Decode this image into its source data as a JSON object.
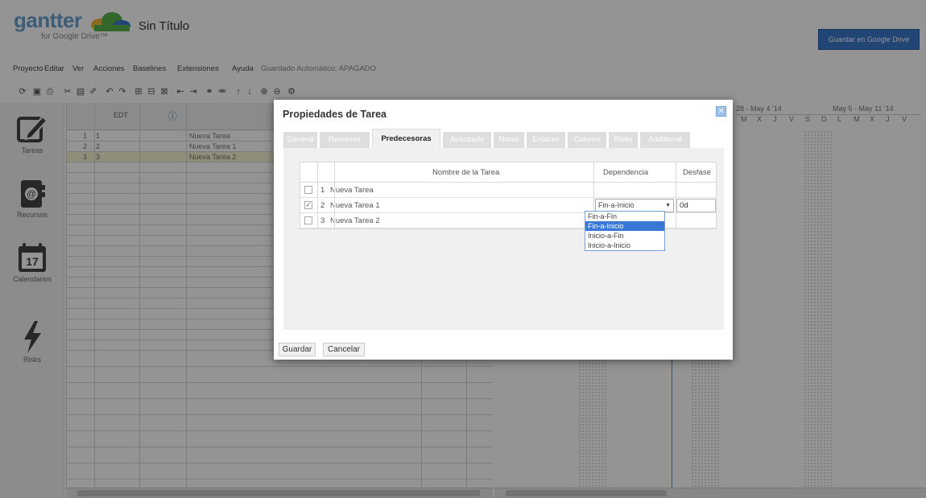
{
  "app": {
    "logo_text": "gantter",
    "logo_sub": "for Google Drive™",
    "title": "Sin Título",
    "save_drive": "Guardar en Google Drive"
  },
  "menu": [
    "Proyecto",
    "Editar",
    "Ver",
    "Acciones",
    "Baselines",
    "Extensiones",
    "Ayuda",
    "Guardado Automático: APAGADO"
  ],
  "nav": [
    {
      "label": "Tareas",
      "icon": "edit-icon"
    },
    {
      "label": "Recursos",
      "icon": "contacts-icon"
    },
    {
      "label": "Calendarios",
      "icon": "calendar-icon",
      "number": "17"
    },
    {
      "label": "Risks",
      "icon": "lightning-icon"
    }
  ],
  "grid": {
    "col_edt": "EDT",
    "rows": [
      {
        "num": "1",
        "edt": "1",
        "name": "Nueva Tarea"
      },
      {
        "num": "2",
        "edt": "2",
        "name": "Nueva Tarea 1"
      },
      {
        "num": "3",
        "edt": "3",
        "name": "Nueva Tarea 2"
      }
    ]
  },
  "gantt": {
    "week1": "28 - May 4 '14",
    "week2": "May 5 - May 11 '14",
    "days": [
      "M",
      "X",
      "J",
      "V",
      "S",
      "D",
      "L",
      "M",
      "X",
      "J",
      "V"
    ]
  },
  "dialog": {
    "title": "Propiedades de Tarea",
    "tabs": [
      "General",
      "Recursos",
      "Predecesoras",
      "Avanzado",
      "Notas",
      "Enlaces",
      "Colores",
      "Risks",
      "Additional"
    ],
    "active_tab": "Predecesoras",
    "table": {
      "col_name": "Nombre de la Tarea",
      "col_dependency": "Dependencia",
      "col_lag": "Desfase",
      "rows": [
        {
          "num": "1",
          "name": "Nueva Tarea",
          "checked": false
        },
        {
          "num": "2",
          "name": "Nueva Tarea 1",
          "checked": true,
          "dependency": "Fin-a-Inicio",
          "lag": "0d"
        },
        {
          "num": "3",
          "name": "Nueva Tarea 2",
          "checked": false
        }
      ]
    },
    "dependency_options": [
      "Fin-a-Fin",
      "Fin-a-Inicio",
      "Inicio-a-Fin",
      "Inicio-a-Inicio"
    ],
    "highlighted_option": "Fin-a-Inicio",
    "save_label": "Guardar",
    "cancel_label": "Cancelar"
  },
  "colors": {
    "accent": "#3a78c9",
    "selected_row": "#f7f4cf",
    "highlight": "#3a78d8"
  }
}
